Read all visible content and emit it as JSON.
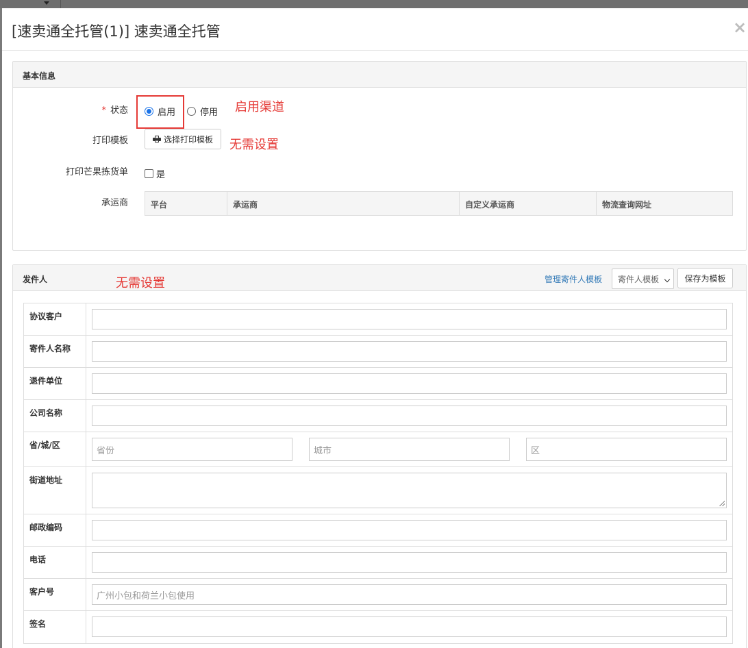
{
  "modal": {
    "title": "[速卖通全托管(1)] 速卖通全托管",
    "close_glyph": "×"
  },
  "basic": {
    "panel_title": "基本信息",
    "status": {
      "label": "状态",
      "required_mark": "*",
      "options": [
        "启用",
        "停用"
      ],
      "selected": "启用"
    },
    "print_template": {
      "label": "打印模板",
      "button_label": "选择打印模板"
    },
    "mango_pick": {
      "label": "打印芒果拣货单",
      "checkbox_label": "是",
      "checked": false
    },
    "carrier": {
      "label": "承运商",
      "columns": [
        "平台",
        "承运商",
        "自定义承运商",
        "物流查询网址"
      ]
    },
    "annotations": {
      "status_note": "启用渠道",
      "template_note": "无需设置"
    }
  },
  "sender": {
    "panel_title": "发件人",
    "annotation": "无需设置",
    "manage_link": "管理寄件人模板",
    "template_select": "寄件人模板",
    "save_button": "保存为模板",
    "rows": {
      "agreement_customer": {
        "label": "协议客户",
        "value": ""
      },
      "sender_name": {
        "label": "寄件人名称",
        "value": ""
      },
      "return_unit": {
        "label": "退件单位",
        "value": ""
      },
      "company_name": {
        "label": "公司名称",
        "value": ""
      },
      "region": {
        "label": "省/城/区",
        "province_placeholder": "省份",
        "city_placeholder": "城市",
        "district_placeholder": "区"
      },
      "street": {
        "label": "街道地址",
        "value": ""
      },
      "postal": {
        "label": "邮政编码",
        "value": ""
      },
      "phone": {
        "label": "电话",
        "value": ""
      },
      "customer_no": {
        "label": "客户号",
        "placeholder": "广州小包和荷兰小包使用"
      },
      "signature": {
        "label": "签名",
        "value": ""
      }
    }
  },
  "colors": {
    "annotation_red": "#e53935",
    "link_blue": "#337ab7",
    "radio_blue": "#1a73e8"
  }
}
